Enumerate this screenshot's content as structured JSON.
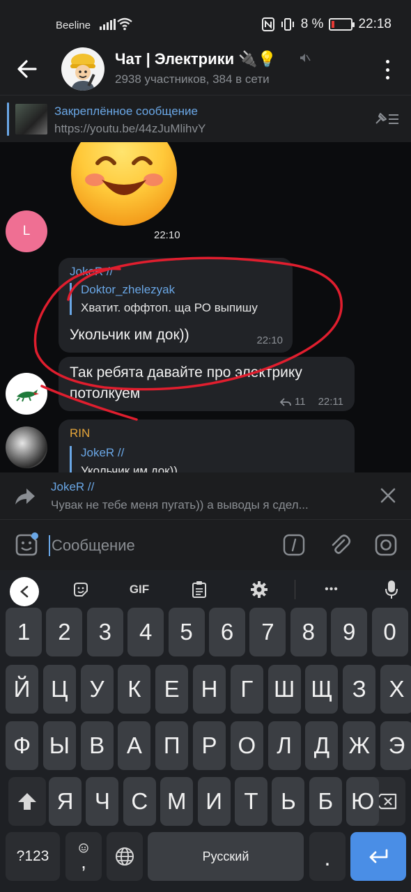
{
  "status_bar": {
    "carrier": "Beeline",
    "battery_text": "8 %",
    "time": "22:18"
  },
  "header": {
    "title": "Чат | Электрики 🔌💡",
    "subtitle": "2938 участников, 384 в сети"
  },
  "pinned": {
    "title": "Закреплённое сообщение",
    "text": "https://youtu.be/44zJuMlihvY"
  },
  "messages": {
    "sticker_time": "22:10",
    "sticker_avatar_letter": "L",
    "m1": {
      "author": "JokeR //",
      "reply_name": "Doktor_zhelezyak",
      "reply_text": "Хватит. оффтоп. ща РО выпишу",
      "text": "Укольчик им док))",
      "time": "22:10"
    },
    "m2": {
      "text": "Так ребята давайте про электрику потолкуем",
      "replies": "11",
      "time": "22:11"
    },
    "m3": {
      "author": "RIN",
      "reply_name": "JokeR //",
      "reply_text": "Укольчик им док))"
    }
  },
  "forward": {
    "name": "JokeR //",
    "text": "Чувак не тебе меня пугать)) а выводы я сдел..."
  },
  "composer": {
    "placeholder": "Сообщение"
  },
  "keyboard": {
    "toolbar": {
      "gif": "GIF",
      "more": "•••"
    },
    "row_numbers": [
      "1",
      "2",
      "3",
      "4",
      "5",
      "6",
      "7",
      "8",
      "9",
      "0"
    ],
    "row1": [
      "Й",
      "Ц",
      "У",
      "К",
      "Е",
      "Н",
      "Г",
      "Ш",
      "Щ",
      "З",
      "Х"
    ],
    "row2": [
      "Ф",
      "Ы",
      "В",
      "А",
      "П",
      "Р",
      "О",
      "Л",
      "Д",
      "Ж",
      "Э"
    ],
    "row3": [
      "Я",
      "Ч",
      "С",
      "М",
      "И",
      "Т",
      "Ь",
      "Б",
      "Ю"
    ],
    "symbols": "?123",
    "comma": ",",
    "space": "Русский",
    "period": "."
  },
  "colors": {
    "accent": "#6aa7e6",
    "author_joker": "#6aa7e6",
    "author_rin": "#e6a63a",
    "annotation": "#e01e2e"
  }
}
